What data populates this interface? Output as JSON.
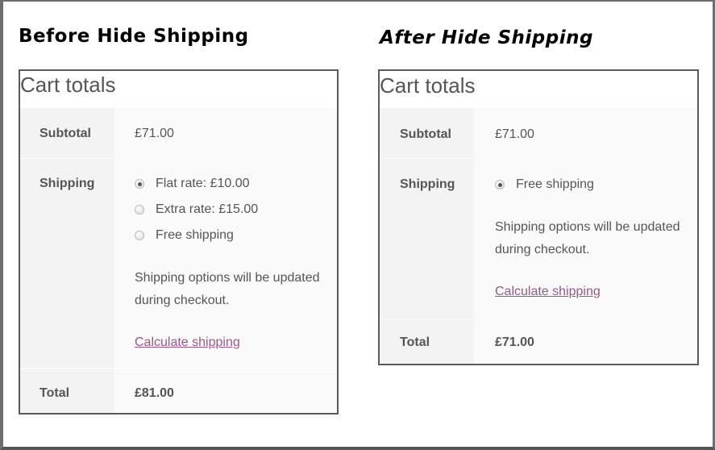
{
  "headings": {
    "before": "Before Hide Shipping",
    "after": "After Hide Shipping"
  },
  "before": {
    "title": "Cart totals",
    "subtotal_label": "Subtotal",
    "subtotal_value": "£71.00",
    "shipping_label": "Shipping",
    "options": [
      {
        "label": "Flat rate: £10.00",
        "checked": true
      },
      {
        "label": "Extra rate: £15.00",
        "checked": false
      },
      {
        "label": "Free shipping",
        "checked": false
      }
    ],
    "note_line1": "Shipping options will be updated",
    "note_line2": "during checkout.",
    "calc_link": "Calculate shipping",
    "total_label": "Total",
    "total_value": "£81.00"
  },
  "after": {
    "title": "Cart totals",
    "subtotal_label": "Subtotal",
    "subtotal_value": "£71.00",
    "shipping_label": "Shipping",
    "options": [
      {
        "label": "Free shipping",
        "checked": true
      }
    ],
    "note_line1": "Shipping options will be updated",
    "note_line2": "during checkout.",
    "calc_link": "Calculate shipping",
    "total_label": "Total",
    "total_value": "£71.00"
  },
  "colors": {
    "link": "#96588a",
    "text": "#555555",
    "border": "#5a5a5a"
  }
}
